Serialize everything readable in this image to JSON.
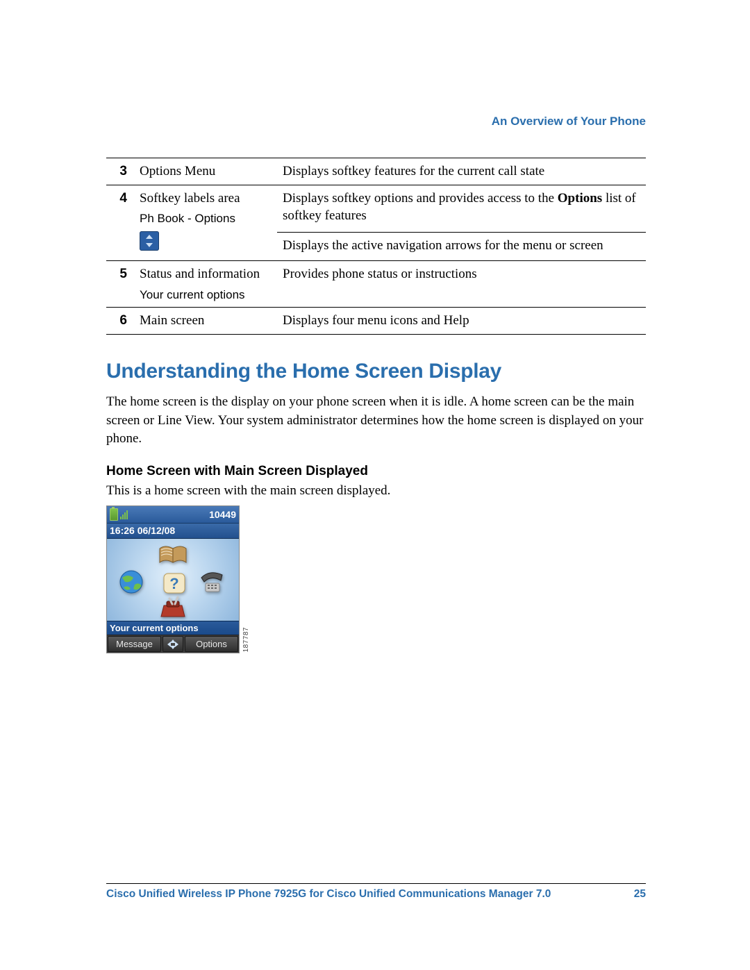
{
  "chapter_header": "An Overview of Your Phone",
  "table": {
    "rows": [
      {
        "num": "3",
        "item_main": "Options Menu",
        "item_sub": "",
        "desc_1": "Displays softkey features for the current call state",
        "desc_2": ""
      },
      {
        "num": "4",
        "item_main": "Softkey labels area",
        "item_sub": "Ph Book - Options",
        "desc_1_pre": "Displays softkey options and provides access to the ",
        "desc_1_bold": "Options",
        "desc_1_post": " list of softkey features",
        "desc_2": "Displays the active navigation arrows for the menu or screen"
      },
      {
        "num": "5",
        "item_main": "Status and information",
        "item_sub": "Your current options",
        "desc_1": "Provides phone status or instructions",
        "desc_2": ""
      },
      {
        "num": "6",
        "item_main": "Main screen",
        "item_sub": "",
        "desc_1": "Displays four menu icons and Help",
        "desc_2": ""
      }
    ]
  },
  "section_title": "Understanding the Home Screen Display",
  "section_body": "The home screen is the display on your phone screen when it is idle. A home screen can be the main screen or Line View. Your system administrator determines how the home screen is displayed on your phone.",
  "sub_heading": "Home Screen with Main Screen Displayed",
  "sub_body": "This is a home screen with the main screen displayed.",
  "phone": {
    "extension": "10449",
    "datetime": "16:26 06/12/08",
    "status_text": "Your current options",
    "softkey_left": "Message",
    "softkey_right": "Options",
    "image_id": "187787"
  },
  "footer": {
    "title": "Cisco Unified Wireless IP Phone 7925G for Cisco Unified Communications Manager 7.0",
    "page": "25"
  }
}
